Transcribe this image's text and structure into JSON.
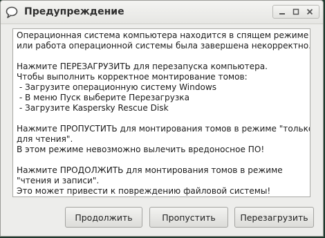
{
  "window": {
    "title": "Предупреждение",
    "icons": {
      "app": "speech-bubble-icon",
      "minimize": "minimize-icon",
      "maximize": "maximize-icon",
      "close": "close-icon"
    }
  },
  "message": {
    "lines": [
      "Операционная система компьютера находится в спящем режиме",
      "или работа операционной системы была завершена некорректно.",
      "",
      "Нажмите ПЕРЕЗАГРУЗИТЬ для перезапуска компьютера.",
      "Чтобы выполнить корректное монтирование томов:",
      " - Загрузите операционную систему Windows",
      " - В меню Пуск выберите Перезагрузка",
      " - Загрузите Kaspersky Rescue Disk",
      "",
      "Нажмите ПРОПУСТИТЬ для монтирования томов в режиме \"только",
      "для чтения\".",
      "В этом режиме невозможно вылечить вредоносное ПО!",
      "",
      "Нажмите ПРОДОЛЖИТЬ для монтирования томов в режиме",
      "\"чтения и записи\".",
      "Это может привести к повреждению файловой системы!"
    ]
  },
  "buttons": {
    "continue": "Продолжить",
    "skip": "Пропустить",
    "restart": "Перезагрузить"
  }
}
